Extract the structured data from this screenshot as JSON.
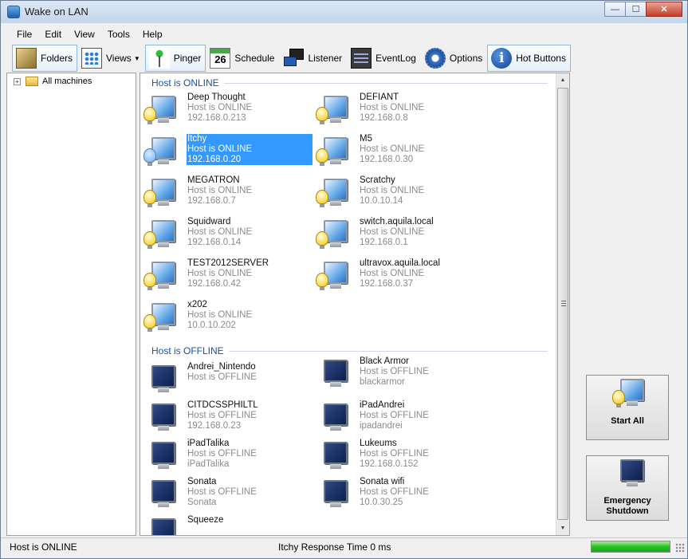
{
  "window": {
    "title": "Wake on LAN",
    "min_label": "—",
    "max_label": "☐",
    "close_label": "✕"
  },
  "menu": [
    "File",
    "Edit",
    "View",
    "Tools",
    "Help"
  ],
  "toolbar": {
    "folders": "Folders",
    "views": "Views",
    "pinger": "Pinger",
    "schedule": "Schedule",
    "schedule_day": "26",
    "listener": "Listener",
    "eventlog": "EventLog",
    "options": "Options",
    "hot_buttons": "Hot Buttons",
    "hot_icon": "i"
  },
  "tree": {
    "expander": "+",
    "root": "All machines"
  },
  "groups": {
    "online": {
      "header": "Host is ONLINE",
      "hosts": [
        {
          "name": "Deep Thought",
          "status": "Host is ONLINE",
          "addr": "192.168.0.213"
        },
        {
          "name": "DEFIANT",
          "status": "Host is ONLINE",
          "addr": "192.168.0.8"
        },
        {
          "name": "Itchy",
          "status": "Host is ONLINE",
          "addr": "192.168.0.20",
          "selected": true
        },
        {
          "name": "M5",
          "status": "Host is ONLINE",
          "addr": "192.168.0.30"
        },
        {
          "name": "MEGATRON",
          "status": "Host is ONLINE",
          "addr": "192.168.0.7"
        },
        {
          "name": "Scratchy",
          "status": "Host is ONLINE",
          "addr": "10.0.10.14"
        },
        {
          "name": "Squidward",
          "status": "Host is ONLINE",
          "addr": "192.168.0.14"
        },
        {
          "name": "switch.aquila.local",
          "status": "Host is ONLINE",
          "addr": "192.168.0.1"
        },
        {
          "name": "TEST2012SERVER",
          "status": "Host is ONLINE",
          "addr": "192.168.0.42"
        },
        {
          "name": "ultravox.aquila.local",
          "status": "Host is ONLINE",
          "addr": "192.168.0.37"
        },
        {
          "name": "x202",
          "status": "Host is ONLINE",
          "addr": "10.0.10.202"
        }
      ]
    },
    "offline": {
      "header": "Host is OFFLINE",
      "hosts": [
        {
          "name": "Andrei_Nintendo",
          "status": "Host is OFFLINE",
          "addr": ""
        },
        {
          "name": "Black Armor",
          "status": "Host is OFFLINE",
          "addr": "blackarmor"
        },
        {
          "name": "CITDCSSPHILTL",
          "status": "Host is OFFLINE",
          "addr": "192.168.0.23"
        },
        {
          "name": "iPadAndrei",
          "status": "Host is OFFLINE",
          "addr": "ipadandrei"
        },
        {
          "name": "iPadTalika",
          "status": "Host is OFFLINE",
          "addr": "iPadTalika"
        },
        {
          "name": "Lukeums",
          "status": "Host is OFFLINE",
          "addr": "192.168.0.152"
        },
        {
          "name": "Sonata",
          "status": "Host is OFFLINE",
          "addr": "Sonata"
        },
        {
          "name": "Sonata wifi",
          "status": "Host is OFFLINE",
          "addr": "10.0.30.25"
        },
        {
          "name": "Squeeze",
          "status": "",
          "addr": ""
        }
      ]
    }
  },
  "scrollbar": {
    "up": "▲",
    "down": "▼"
  },
  "side": {
    "start_all": "Start All",
    "emergency_line1": "Emergency",
    "emergency_line2": "Shutdown"
  },
  "status": {
    "left": "Host is ONLINE",
    "center": "Itchy Response Time 0 ms",
    "progress_percent": 100
  },
  "colors": {
    "group_header": "#1e4ea6",
    "selection": "#3399ff",
    "progress": "#26c32a"
  }
}
